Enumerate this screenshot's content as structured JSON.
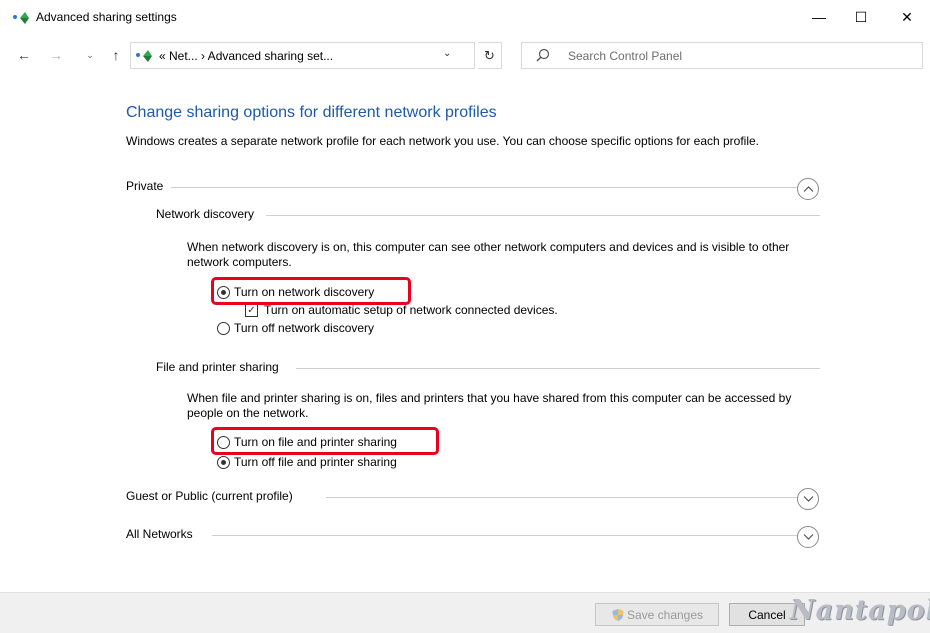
{
  "window": {
    "title": "Advanced sharing settings",
    "minimize_glyph": "—",
    "maximize_glyph": "☐",
    "close_glyph": "✕"
  },
  "navigation": {
    "back_glyph": "←",
    "forward_glyph": "→",
    "recent_glyph": "⌄",
    "up_glyph": "↑",
    "address": "«   Net...  ›  Advanced sharing set...",
    "address_dropdown_glyph": "⌄",
    "refresh_glyph": "↻",
    "search_placeholder": "Search Control Panel"
  },
  "content": {
    "heading": "Change sharing options for different network profiles",
    "description": "Windows creates a separate network profile for each network you use. You can choose specific options for each profile.",
    "profiles": {
      "private": {
        "label": "Private",
        "expanded": true,
        "network_discovery": {
          "label": "Network discovery",
          "description": "When network discovery is on, this computer can see other network computers and devices and is visible to other network computers.",
          "option_on": "Turn on network discovery",
          "option_on_selected": true,
          "auto_setup": "Turn on automatic setup of network connected devices.",
          "auto_setup_checked": true,
          "option_off": "Turn off network discovery"
        },
        "file_printer_sharing": {
          "label": "File and printer sharing",
          "description": "When file and printer sharing is on, files and printers that you have shared from this computer can be accessed by people on the network.",
          "option_on": "Turn on file and printer sharing",
          "option_off": "Turn off file and printer sharing",
          "option_off_selected": true
        }
      },
      "guest_public": {
        "label": "Guest or Public (current profile)",
        "expanded": false
      },
      "all_networks": {
        "label": "All Networks",
        "expanded": false
      }
    }
  },
  "footer": {
    "save_label": "Save changes",
    "save_enabled": false,
    "cancel_label": "Cancel",
    "watermark": "Nantapol"
  },
  "colors": {
    "heading": "#1e5aa8",
    "highlight": "#e8001c",
    "footer_bg": "#f0f0f0"
  },
  "icons": {
    "window": "network-sharing-icon",
    "search": "search-icon",
    "save": "uac-shield-icon"
  }
}
